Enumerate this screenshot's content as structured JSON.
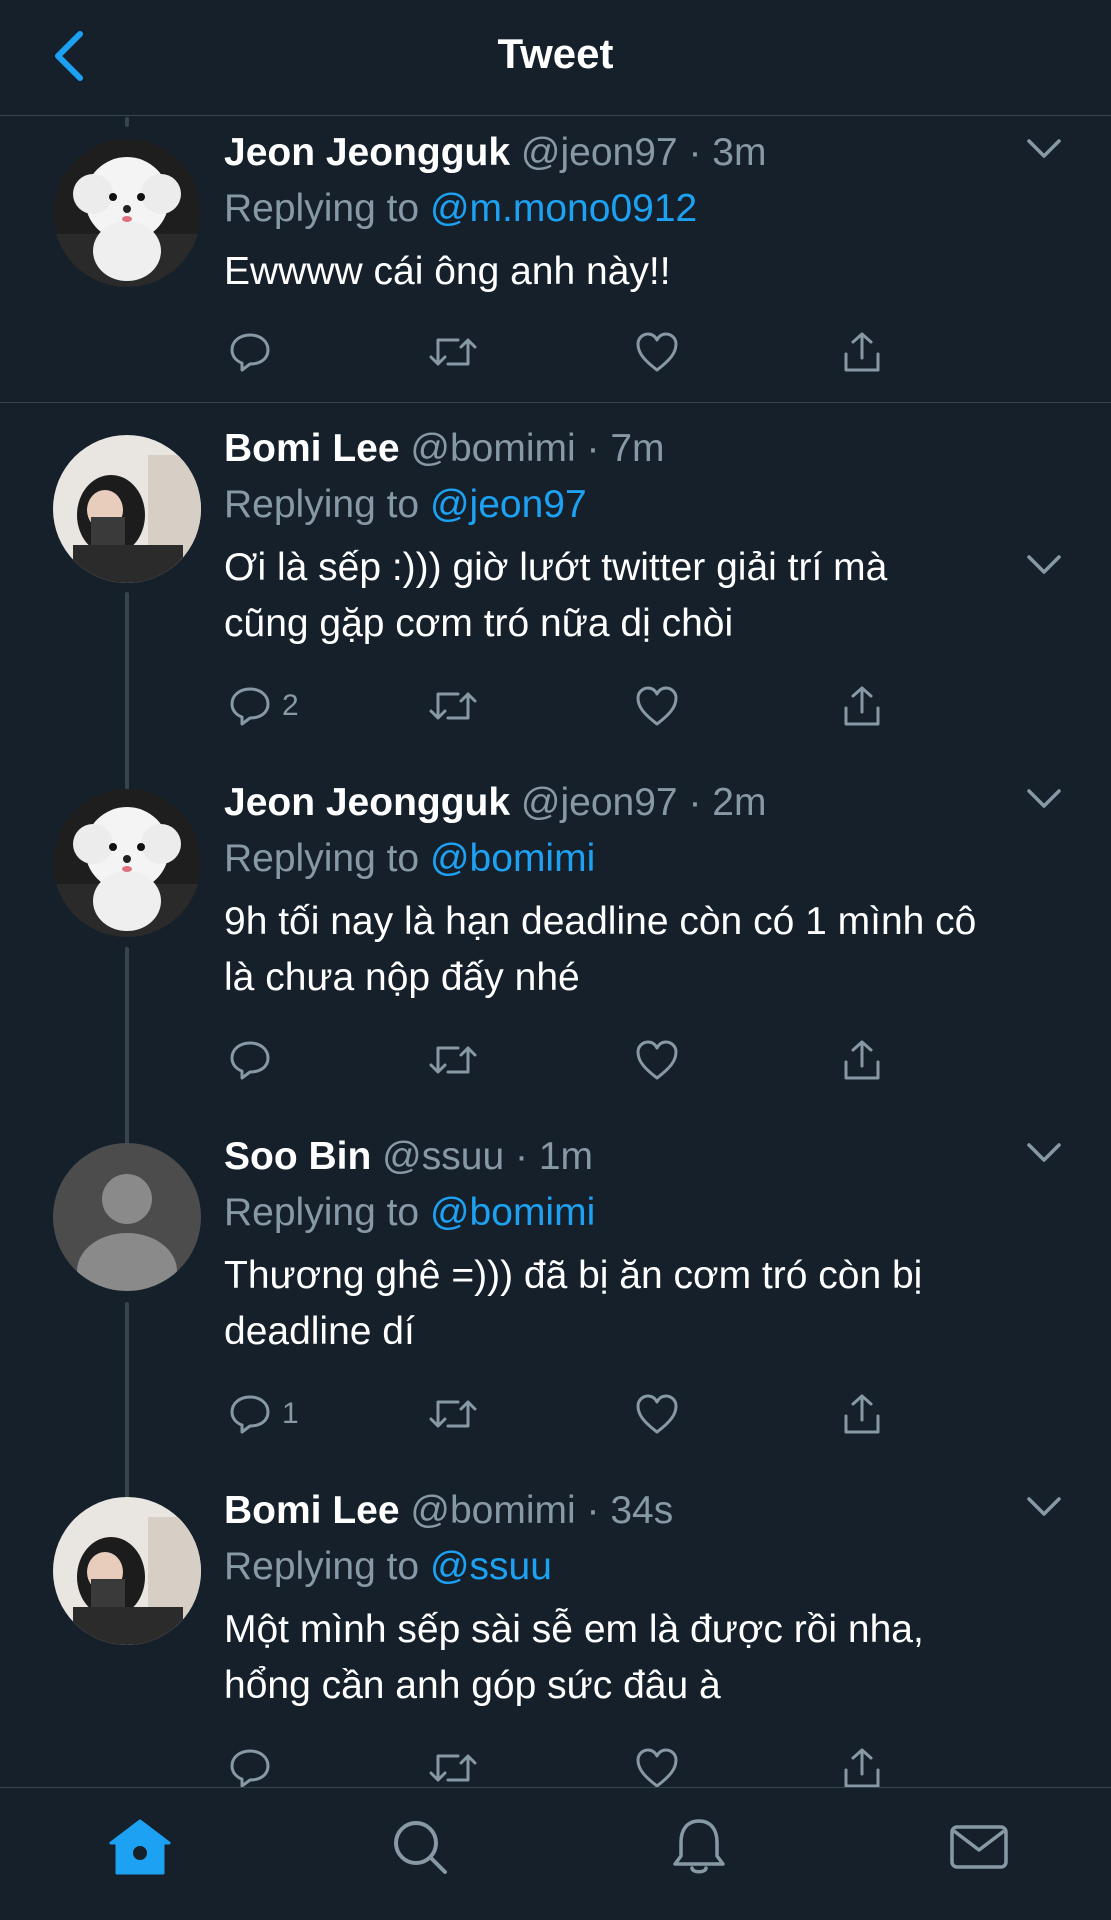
{
  "header": {
    "title": "Tweet"
  },
  "colors": {
    "background": "#15202b",
    "accent": "#1da1f2",
    "muted": "#8899a6",
    "divider": "#38444d"
  },
  "tweets": [
    {
      "name": "Jeon Jeongguk",
      "handle": "@jeon97",
      "time": "3m",
      "reply_prefix": "Replying to",
      "reply_to": "@m.mono0912",
      "lines": [
        "Ewwww cái ông anh này!!"
      ],
      "reply_count": "",
      "avatar": "white-dog-avatar"
    },
    {
      "name": "Bomi Lee",
      "handle": "@bomimi",
      "time": "7m",
      "reply_prefix": "Replying to",
      "reply_to": "@jeon97",
      "lines": [
        "Ơi là sếp :))) giờ lướt twitter giải trí mà",
        "cũng gặp cơm tró nữa dị chòi"
      ],
      "reply_count": "2",
      "avatar": "girl-photo-avatar"
    },
    {
      "name": "Jeon Jeongguk",
      "handle": "@jeon97",
      "time": "2m",
      "reply_prefix": "Replying to",
      "reply_to": "@bomimi",
      "lines": [
        "9h tối nay là hạn deadline còn có 1 mình cô",
        "là chưa nộp đấy nhé"
      ],
      "reply_count": "",
      "avatar": "white-dog-avatar"
    },
    {
      "name": "Soo Bin",
      "handle": "@ssuu",
      "time": "1m",
      "reply_prefix": "Replying to",
      "reply_to": "@bomimi",
      "lines": [
        "Thương ghê =))) đã bị ăn cơm tró còn bị",
        "deadline dí"
      ],
      "reply_count": "1",
      "avatar": "default-user-avatar"
    },
    {
      "name": "Bomi Lee",
      "handle": "@bomimi",
      "time": "34s",
      "reply_prefix": "Replying to",
      "reply_to": "@ssuu",
      "lines": [
        "Một mình sếp sài sễ em là được rồi nha,",
        "hổng cần anh góp sức đâu à"
      ],
      "reply_count": "",
      "avatar": "girl-photo-avatar"
    }
  ],
  "tabbar": {
    "active": "home",
    "items": [
      "home-icon",
      "search-icon",
      "bell-icon",
      "mail-icon"
    ]
  }
}
